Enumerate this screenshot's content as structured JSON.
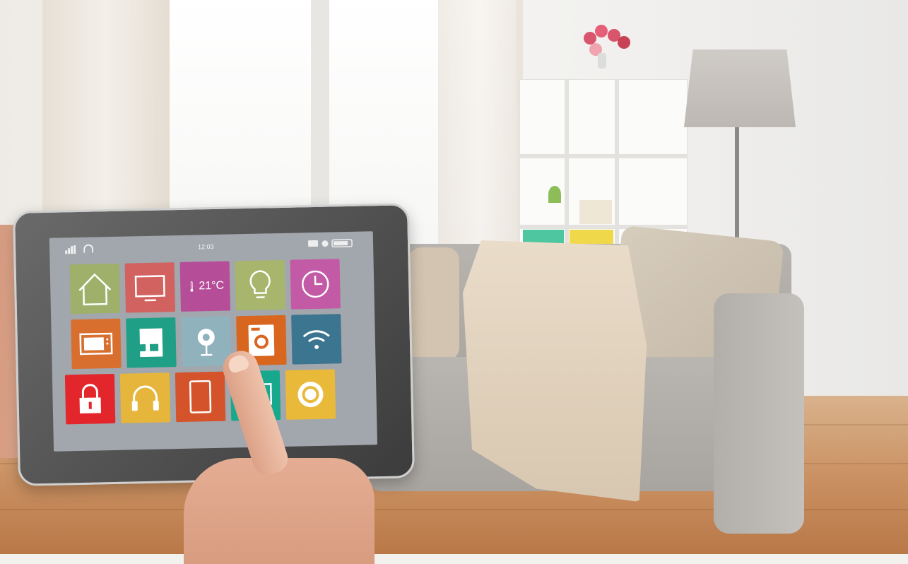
{
  "status_bar": {
    "time": "12:03"
  },
  "tiles": [
    {
      "name": "home-tile",
      "icon": "house-icon",
      "color": "#9eb06a"
    },
    {
      "name": "tv-tile",
      "icon": "tv-icon",
      "color": "#d2625f"
    },
    {
      "name": "thermostat-tile",
      "icon": "thermometer-icon",
      "label": "21°C",
      "color": "#b64d98"
    },
    {
      "name": "light-tile",
      "icon": "lightbulb-icon",
      "color": "#a8b56c"
    },
    {
      "name": "clock-tile",
      "icon": "clock-icon",
      "color": "#c35aa6"
    },
    {
      "name": "microwave-tile",
      "icon": "microwave-icon",
      "color": "#d86f2f"
    },
    {
      "name": "coffee-machine-tile",
      "icon": "coffee-machine-icon",
      "color": "#1f9f86"
    },
    {
      "name": "camera-tile",
      "icon": "webcam-icon",
      "color": "#8fb2bd"
    },
    {
      "name": "washing-machine-tile",
      "icon": "washing-machine-icon",
      "color": "#d8661f"
    },
    {
      "name": "wifi-tile",
      "icon": "wifi-icon",
      "color": "#3b7590"
    },
    {
      "name": "lock-tile",
      "icon": "lock-icon",
      "color": "#e3262b"
    },
    {
      "name": "headphones-tile",
      "icon": "headphones-icon",
      "color": "#e5b63b"
    },
    {
      "name": "tablet-tile",
      "icon": "tablet-icon",
      "color": "#d4532a"
    },
    {
      "name": "monitor-tile",
      "icon": "monitor-icon",
      "color": "#18a88d"
    },
    {
      "name": "settings-tile",
      "icon": "gear-icon",
      "color": "#e9b93a"
    }
  ]
}
